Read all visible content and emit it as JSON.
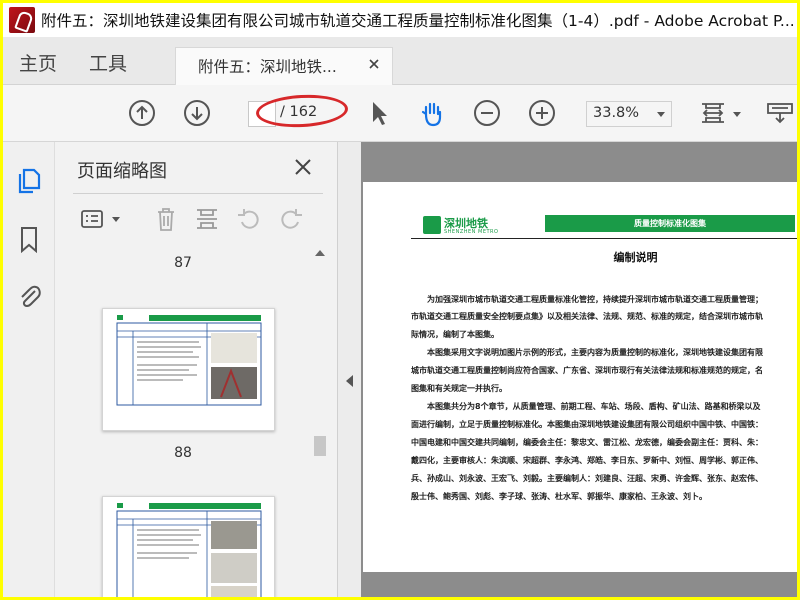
{
  "window": {
    "title": "附件五：深圳地铁建设集团有限公司城市轨道交通工程质量控制标准化图集（1-4）.pdf - Adobe Acrobat P..."
  },
  "menu": {
    "home": "主页",
    "tools": "工具"
  },
  "tab": {
    "label": "附件五：深圳地铁..."
  },
  "toolbar": {
    "current_page": "",
    "page_total": "/ 162",
    "zoom": "33.8%",
    "icons": [
      "arrow-up-circle-icon",
      "arrow-down-circle-icon",
      "pointer-icon",
      "hand-icon",
      "zoom-out-icon",
      "zoom-in-icon",
      "page-fit-icon",
      "comment-tool-icon"
    ],
    "annotation_color": "#d7282a"
  },
  "rail": {
    "icons": [
      "page-thumbnails-icon",
      "bookmark-icon",
      "attachment-icon"
    ],
    "active_color": "#1473e6"
  },
  "panel": {
    "title": "页面缩略图",
    "thumbnails": [
      {
        "page": "87"
      },
      {
        "page": "88"
      }
    ]
  },
  "document": {
    "logo_text": "深圳地铁",
    "logo_sub": "SHENZHEN METRO",
    "header_bar": "质量控制标准化图集",
    "heading": "编制说明",
    "lines": [
      "为加强深圳市城市轨道交通工程质量标准化管控，持续提升深圳市城市轨道交通工程质量管理；",
      "市轨道交通工程质量安全控制要点集》以及相关法律、法规、规范、标准的规定，结合深圳市城市轨",
      "际情况，编制了本图集。",
      "本图集采用文字说明加图片示例的形式，主要内容为质量控制的标准化，深圳地铁建设集团有限",
      "城市轨道交通工程质量控制尚应符合国家、广东省、深圳市现行有关法律法规和标准规范的规定，名",
      "图集和有关规定一并执行。",
      "本图集共分为8个章节，从质量管理、前期工程、车站、场段、盾构、矿山法、路基和桥梁以及",
      "面进行编制，立足于质量控制标准化。本图集由深圳地铁建设集团有限公司组织中国中铁、中国铁：",
      "中国电建和中国交建共同编制，编委会主任：黎忠文、雷江松、龙宏德，编委会副主任：贾科、朱：",
      "戴四化，主要审核人：朱滨顺、宋超群、李永鸿、郑皓、李日东、罗新中、刘恒、周学彬、郭正伟、",
      "兵、孙成山、刘永波、王宏飞、刘毅。主要编制人：刘建良、汪超、宋勇、许金辉、张东、赵宏伟、",
      "殷士伟、鲍秀国、刘彪、李子球、张涛、杜水军、郭振华、康家柏、王永波、刘卜。"
    ],
    "accent": "#1a9b48"
  }
}
